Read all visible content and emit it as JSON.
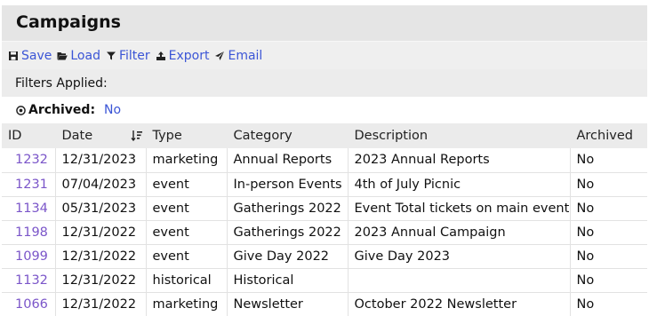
{
  "page": {
    "title": "Campaigns"
  },
  "toolbar": {
    "items": [
      {
        "label": "Save",
        "icon": "floppy-icon"
      },
      {
        "label": "Load",
        "icon": "folder-open-icon"
      },
      {
        "label": "Filter",
        "icon": "funnel-icon"
      },
      {
        "label": "Export",
        "icon": "export-icon"
      },
      {
        "label": "Email",
        "icon": "paper-plane-icon"
      }
    ]
  },
  "filters": {
    "label": "Filters Applied:",
    "items": [
      {
        "name": "Archived:",
        "value": "No"
      }
    ]
  },
  "table": {
    "columns": [
      "ID",
      "Date",
      "Type",
      "Category",
      "Description",
      "Archived"
    ],
    "sort": {
      "column": "Date",
      "direction": "descending"
    },
    "rows": [
      [
        "1232",
        "12/31/2023",
        "marketing",
        "Annual Reports",
        "2023 Annual Reports",
        "No"
      ],
      [
        "1231",
        "07/04/2023",
        "event",
        "In-person Events",
        "4th of July Picnic",
        "No"
      ],
      [
        "1134",
        "05/31/2023",
        "event",
        "Gatherings 2022",
        "Event Total tickets on main event",
        "No"
      ],
      [
        "1198",
        "12/31/2022",
        "event",
        "Gatherings 2022",
        "2023 Annual Campaign",
        "No"
      ],
      [
        "1099",
        "12/31/2022",
        "event",
        "Give Day 2022",
        "Give Day 2023",
        "No"
      ],
      [
        "1132",
        "12/31/2022",
        "historical",
        "Historical",
        "",
        "No"
      ],
      [
        "1066",
        "12/31/2022",
        "marketing",
        "Newsletter",
        "October 2022 Newsletter",
        "No"
      ]
    ]
  },
  "colors": {
    "link": "#3b55d6",
    "id_link": "#7b56c9",
    "header_bg": "#e5e5e5"
  }
}
